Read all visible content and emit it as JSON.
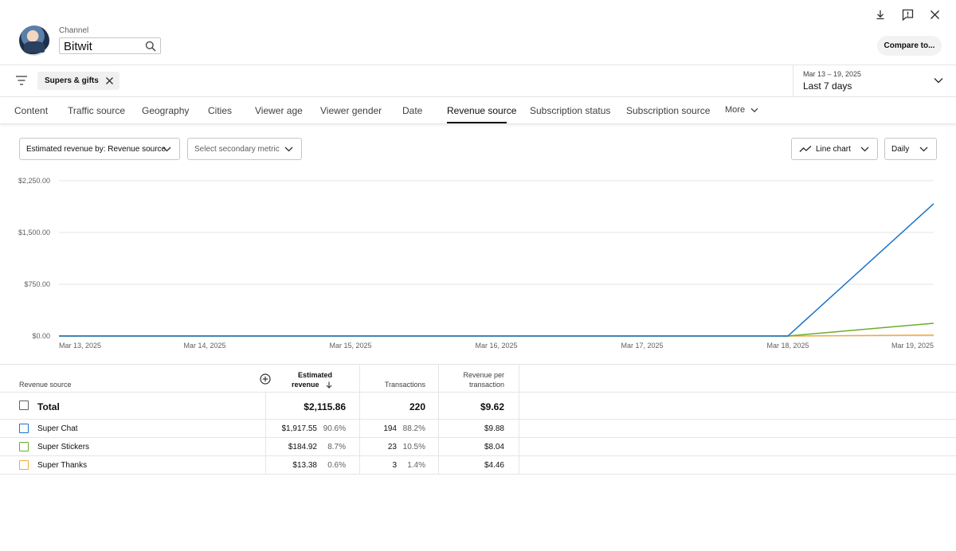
{
  "header": {
    "channel_label": "Channel",
    "channel_name": "Bitwit",
    "compare_label": "Compare to..."
  },
  "filter": {
    "chip_label": "Supers & gifts",
    "date_range": "Mar 13 – 19, 2025",
    "date_label": "Last 7 days"
  },
  "tabs": [
    {
      "label": "Content"
    },
    {
      "label": "Traffic source"
    },
    {
      "label": "Geography"
    },
    {
      "label": "Cities"
    },
    {
      "label": "Viewer age"
    },
    {
      "label": "Viewer gender"
    },
    {
      "label": "Date"
    },
    {
      "label": "Revenue source"
    },
    {
      "label": "Subscription status"
    },
    {
      "label": "Subscription source"
    },
    {
      "label": "More"
    }
  ],
  "active_tab": "Revenue source",
  "controls": {
    "metric": "Estimated revenue by: Revenue source",
    "secondary_placeholder": "Select secondary metric",
    "chart_type": "Line chart",
    "interval": "Daily"
  },
  "colors": {
    "super_chat": "#1a73c8",
    "super_stickers": "#6aae2a",
    "super_thanks": "#f2a93b"
  },
  "chart_data": {
    "type": "line",
    "x": [
      "Mar 13, 2025",
      "Mar 14, 2025",
      "Mar 15, 2025",
      "Mar 16, 2025",
      "Mar 17, 2025",
      "Mar 18, 2025",
      "Mar 19, 2025"
    ],
    "y_ticks": [
      "$2,250.00",
      "$1,500.00",
      "$750.00",
      "$0.00"
    ],
    "y_tick_values": [
      2250,
      1500,
      750,
      0
    ],
    "ylim": [
      0,
      2250
    ],
    "grid": true,
    "series": [
      {
        "name": "Super Chat",
        "color": "#1a73c8",
        "values": [
          0,
          0,
          0,
          0,
          0,
          0,
          1917.55
        ]
      },
      {
        "name": "Super Stickers",
        "color": "#6aae2a",
        "values": [
          0,
          0,
          0,
          0,
          0,
          0,
          184.92
        ]
      },
      {
        "name": "Super Thanks",
        "color": "#f2a93b",
        "values": [
          0,
          0,
          0,
          0,
          0,
          0,
          13.38
        ]
      }
    ]
  },
  "table": {
    "headers": {
      "source": "Revenue source",
      "revenue_line1": "Estimated",
      "revenue_line2": "revenue",
      "transactions": "Transactions",
      "rpt_line1": "Revenue per",
      "rpt_line2": "transaction"
    },
    "total": {
      "label": "Total",
      "revenue": "$2,115.86",
      "transactions": "220",
      "rpt": "$9.62"
    },
    "rows": [
      {
        "label": "Super Chat",
        "revenue": "$1,917.55",
        "revenue_pct": "90.6%",
        "transactions": "194",
        "transactions_pct": "88.2%",
        "rpt": "$9.88",
        "color": "#1a73c8"
      },
      {
        "label": "Super Stickers",
        "revenue": "$184.92",
        "revenue_pct": "8.7%",
        "transactions": "23",
        "transactions_pct": "10.5%",
        "rpt": "$8.04",
        "color": "#6aae2a"
      },
      {
        "label": "Super Thanks",
        "revenue": "$13.38",
        "revenue_pct": "0.6%",
        "transactions": "3",
        "transactions_pct": "1.4%",
        "rpt": "$4.46",
        "color": "#f2a93b"
      }
    ]
  }
}
